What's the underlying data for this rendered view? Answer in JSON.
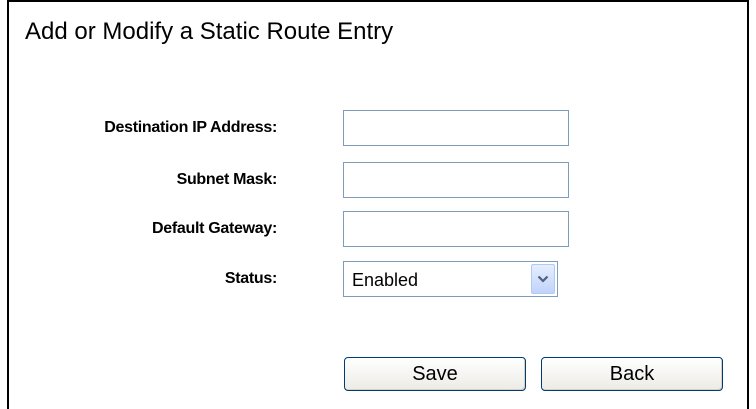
{
  "header": {
    "title": "Add or Modify a Static Route Entry"
  },
  "form": {
    "destination_label": "Destination IP Address:",
    "destination_value": "",
    "subnet_label": "Subnet Mask:",
    "subnet_value": "",
    "gateway_label": "Default Gateway:",
    "gateway_value": "",
    "status_label": "Status:",
    "status_value": "Enabled"
  },
  "buttons": {
    "save_label": "Save",
    "back_label": "Back"
  },
  "icons": {
    "status_dropdown": "chevron-down-icon"
  }
}
